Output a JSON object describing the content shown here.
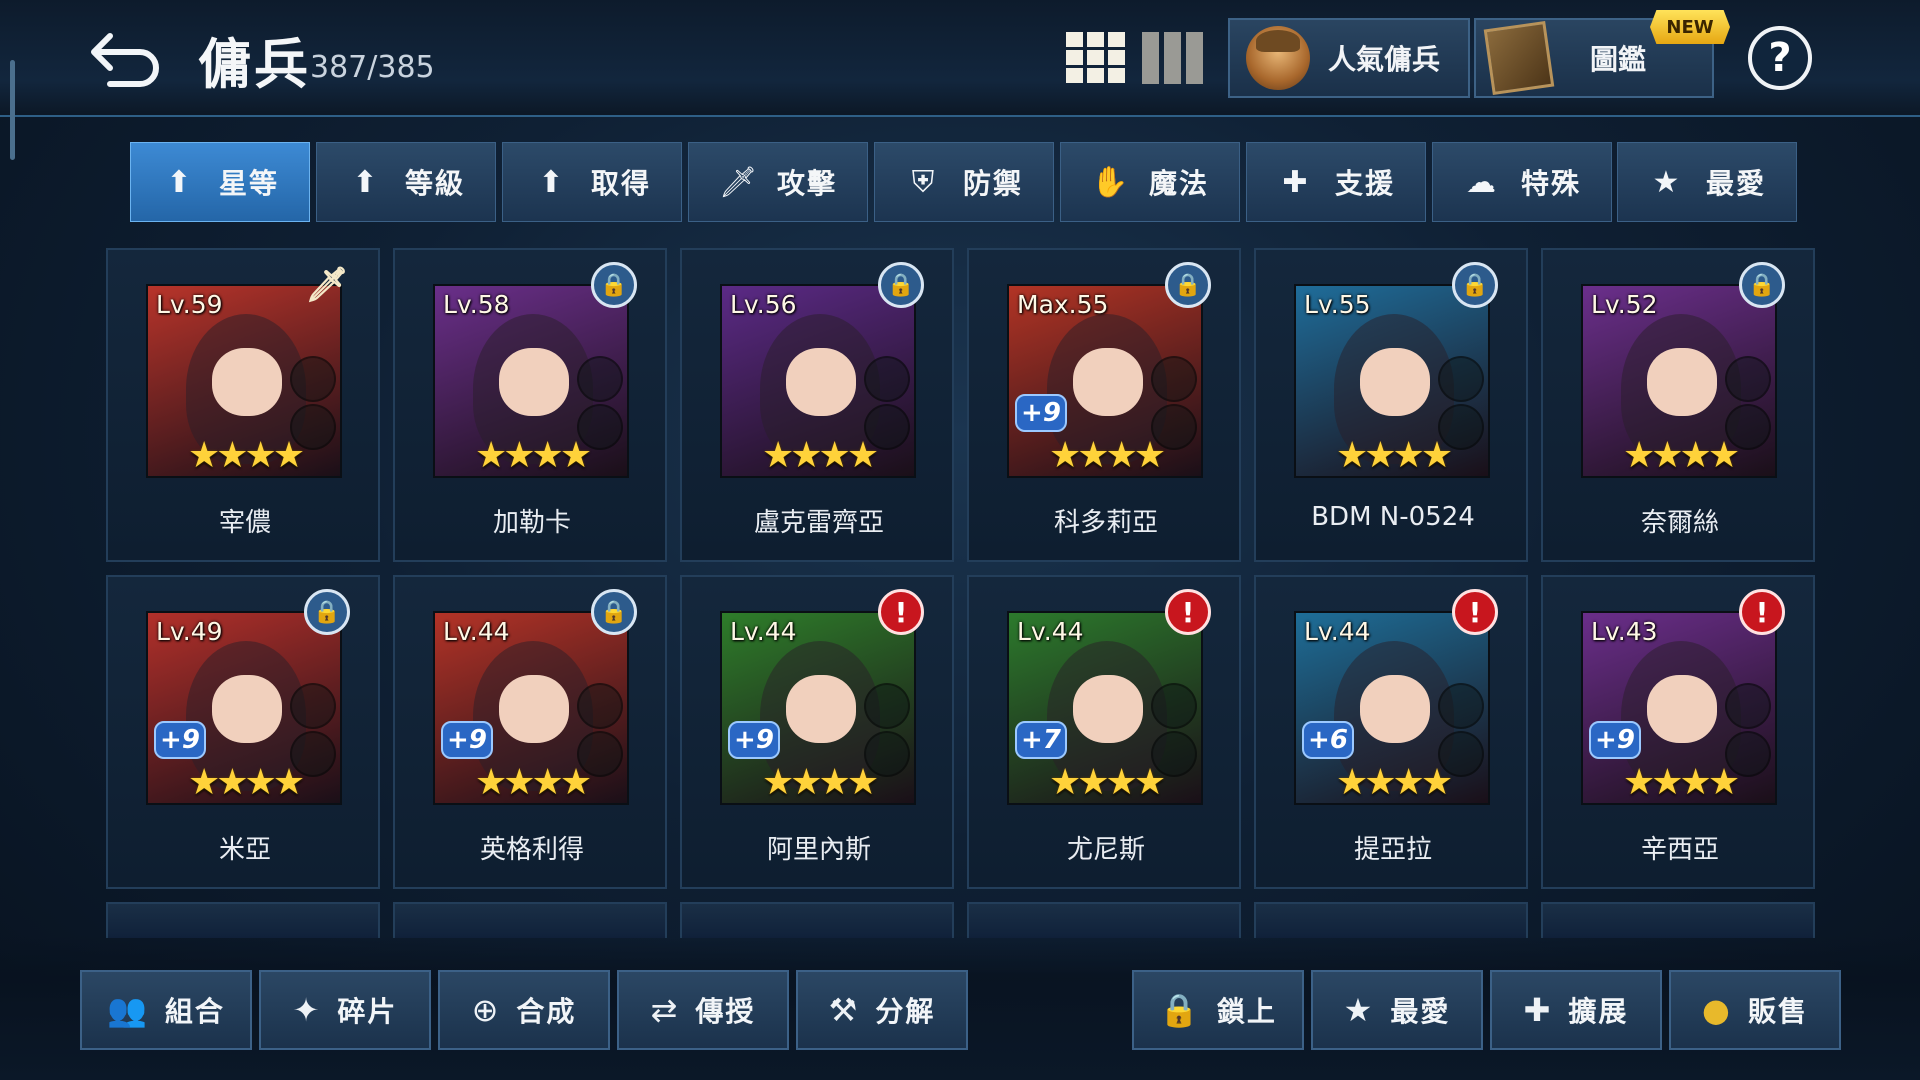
{
  "header": {
    "title": "傭兵",
    "count": "387/385",
    "popular_label": "人氣傭兵",
    "codex_label": "圖鑑",
    "new_badge": "NEW",
    "help": "?"
  },
  "sort_tabs": [
    {
      "label": "星等",
      "icon": "arrow-up-icon",
      "glyph": "⬆",
      "active": true
    },
    {
      "label": "等級",
      "icon": "arrow-up-icon",
      "glyph": "⬆"
    },
    {
      "label": "取得",
      "icon": "arrow-up-icon",
      "glyph": "⬆"
    },
    {
      "label": "攻擊",
      "icon": "sword-icon",
      "glyph": "🗡"
    },
    {
      "label": "防禦",
      "icon": "shield-icon",
      "glyph": "⛨"
    },
    {
      "label": "魔法",
      "icon": "magic-hand-icon",
      "glyph": "✋"
    },
    {
      "label": "支援",
      "icon": "support-icon",
      "glyph": "✚"
    },
    {
      "label": "特殊",
      "icon": "cloud-icon",
      "glyph": "☁"
    },
    {
      "label": "最愛",
      "icon": "star-icon",
      "glyph": "★"
    }
  ],
  "mercenaries": [
    {
      "level": "Lv.59",
      "name": "宰儂",
      "stars": "★★★★",
      "plus": "",
      "badge": "sword",
      "bg": "#b8342a"
    },
    {
      "level": "Lv.58",
      "name": "加勒卡",
      "stars": "★★★★",
      "plus": "",
      "badge": "lock",
      "bg": "#6a2f8a"
    },
    {
      "level": "Lv.56",
      "name": "盧克雷齊亞",
      "stars": "★★★★",
      "plus": "",
      "badge": "lock",
      "bg": "#5b2a86"
    },
    {
      "level": "Max.55",
      "name": "科多莉亞",
      "stars": "★★★★",
      "plus": "+9",
      "badge": "lock",
      "bg": "#b23425"
    },
    {
      "level": "Lv.55",
      "name": "BDM N-0524",
      "stars": "★★★★",
      "plus": "",
      "badge": "lock",
      "bg": "#1f6d9a"
    },
    {
      "level": "Lv.52",
      "name": "奈爾絲",
      "stars": "★★★★",
      "plus": "",
      "badge": "lock",
      "bg": "#6b2f8c"
    },
    {
      "level": "Lv.49",
      "name": "米亞",
      "stars": "★★★★",
      "plus": "+9",
      "badge": "lock",
      "bg": "#b2302a"
    },
    {
      "level": "Lv.44",
      "name": "英格利得",
      "stars": "★★★★",
      "plus": "+9",
      "badge": "lock",
      "bg": "#b33327"
    },
    {
      "level": "Lv.44",
      "name": "阿里內斯",
      "stars": "★★★★",
      "plus": "+9",
      "badge": "alert",
      "bg": "#2e7d2a"
    },
    {
      "level": "Lv.44",
      "name": "尤尼斯",
      "stars": "★★★★",
      "plus": "+7",
      "badge": "alert",
      "bg": "#2c7a2c"
    },
    {
      "level": "Lv.44",
      "name": "提亞拉",
      "stars": "★★★★",
      "plus": "+6",
      "badge": "alert",
      "bg": "#1e6e98"
    },
    {
      "level": "Lv.43",
      "name": "辛西亞",
      "stars": "★★★★",
      "plus": "+9",
      "badge": "alert",
      "bg": "#6a2e8a"
    }
  ],
  "bottom_left": [
    {
      "label": "組合",
      "icon": "team-icon",
      "glyph": "👥"
    },
    {
      "label": "碎片",
      "icon": "fragments-icon",
      "glyph": "✦"
    },
    {
      "label": "合成",
      "icon": "merge-icon",
      "glyph": "⊕"
    },
    {
      "label": "傳授",
      "icon": "transfer-icon",
      "glyph": "⇄"
    },
    {
      "label": "分解",
      "icon": "hammer-icon",
      "glyph": "⚒"
    }
  ],
  "bottom_right": [
    {
      "label": "鎖上",
      "icon": "lock-icon",
      "glyph": "🔒"
    },
    {
      "label": "最愛",
      "icon": "star-icon",
      "glyph": "★"
    },
    {
      "label": "擴展",
      "icon": "plus-icon",
      "glyph": "✚"
    },
    {
      "label": "販售",
      "icon": "gold-coin-icon",
      "glyph": "●"
    }
  ],
  "colors": {
    "active_tab": "#3d8ad4",
    "alert": "#c8161e",
    "lock": "#2d5b8c",
    "stars": "#ffd23a"
  }
}
